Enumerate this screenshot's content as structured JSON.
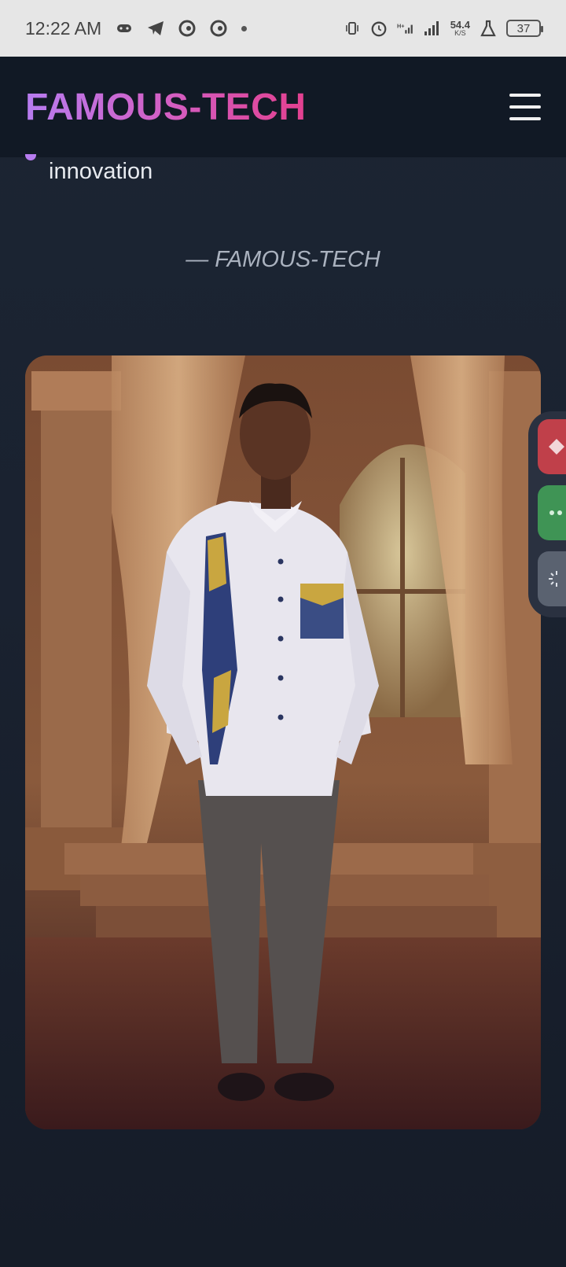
{
  "status_bar": {
    "time": "12:22 AM",
    "net_speed_value": "54.4",
    "net_speed_unit": "K/S",
    "battery_level": "37",
    "left_icons": [
      "game-controller-icon",
      "telegram-icon",
      "opera-icon",
      "opera-icon",
      "dot-icon"
    ],
    "right_icons": [
      "vibrate-icon",
      "alarm-icon",
      "signal-hplus-icon",
      "signal-icon",
      "lab-flask-icon",
      "battery-icon"
    ]
  },
  "header": {
    "brand": "FAMOUS-TECH",
    "menu_icon": "hamburger-menu-icon"
  },
  "quote": {
    "tail_word": "innovation",
    "attribution": "— FAMOUS-TECH"
  },
  "photo": {
    "subject": "portrait-photo"
  },
  "side_dock": {
    "buttons": [
      "diamond-icon",
      "dots-icon",
      "sparkle-icon"
    ]
  },
  "colors": {
    "brand_gradient_start": "#b77cf0",
    "brand_gradient_end": "#e2408f",
    "background": "#1a2230",
    "header_bg": "#111925"
  }
}
